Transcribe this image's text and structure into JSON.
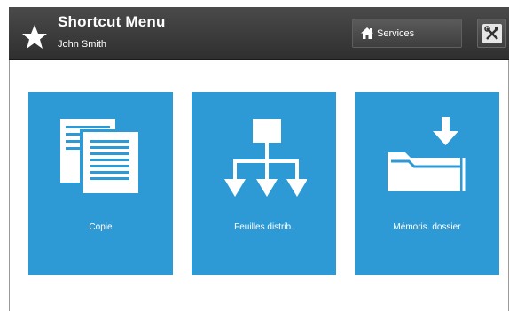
{
  "header": {
    "title": "Shortcut Menu",
    "user": "John Smith",
    "services_label": "Services",
    "icons": [
      "star-icon",
      "home-icon",
      "tools-icon"
    ]
  },
  "tiles": [
    {
      "label": "Copie",
      "icon": "copy-documents-icon"
    },
    {
      "label": "Feuilles distrib.",
      "icon": "distribution-tree-icon"
    },
    {
      "label": "Mémoris. dossier",
      "icon": "folder-store-icon"
    }
  ],
  "colors": {
    "header": "#3a3a3a",
    "tile": "#2e9ad5",
    "text": "#ffffff"
  }
}
